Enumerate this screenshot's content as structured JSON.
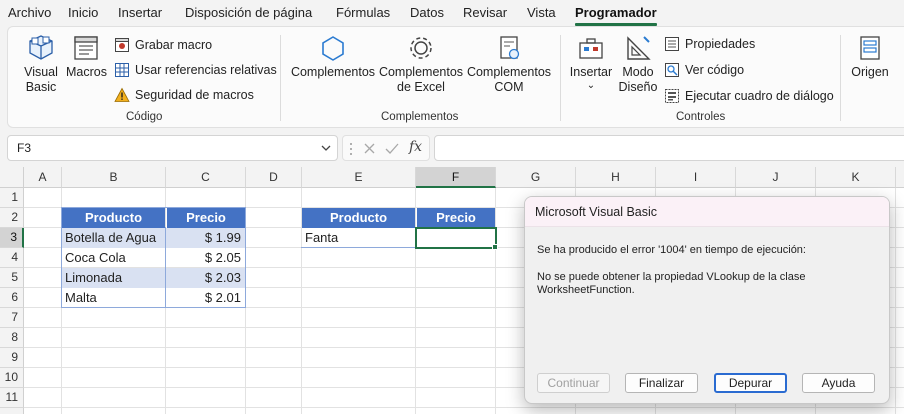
{
  "menu": {
    "tabs": [
      "Archivo",
      "Inicio",
      "Insertar",
      "Disposición de página",
      "Fórmulas",
      "Datos",
      "Revisar",
      "Vista",
      "Programador"
    ],
    "active": "Programador"
  },
  "ribbon": {
    "codigo": {
      "label": "Código",
      "visual_basic": [
        "Visual",
        "Basic"
      ],
      "macros": "Macros",
      "grabar_macro": "Grabar macro",
      "usar_referencias": "Usar referencias relativas",
      "seguridad": "Seguridad de macros"
    },
    "complementos": {
      "label": "Complementos",
      "complementos": "Complementos",
      "complementos_excel": [
        "Complementos",
        "de Excel"
      ],
      "complementos_com": [
        "Complementos",
        "COM"
      ]
    },
    "controles": {
      "label": "Controles",
      "insertar": "Insertar",
      "modo_diseno": [
        "Modo",
        "Diseño"
      ],
      "propiedades": "Propiedades",
      "ver_codigo": "Ver código",
      "ejecutar_cuadro": "Ejecutar cuadro de diálogo"
    },
    "xml": {
      "origen": "Origen"
    }
  },
  "formula_bar": {
    "name_box": "F3",
    "fx": "fx",
    "value": ""
  },
  "grid": {
    "columns": [
      "A",
      "B",
      "C",
      "D",
      "E",
      "F",
      "G",
      "H",
      "I",
      "J",
      "K"
    ],
    "rows": [
      "1",
      "2",
      "3",
      "4",
      "5",
      "6",
      "7",
      "8",
      "9",
      "10",
      "11"
    ],
    "selected_col": "F",
    "selected_row": "3",
    "table1": {
      "headers": [
        "Producto",
        "Precio"
      ],
      "rows": [
        [
          "Botella de Agua",
          "$ 1.99"
        ],
        [
          "Coca Cola",
          "$ 2.05"
        ],
        [
          "Limonada",
          "$ 2.03"
        ],
        [
          "Malta",
          "$ 2.01"
        ]
      ]
    },
    "table2": {
      "headers": [
        "Producto",
        "Precio"
      ],
      "rows": [
        [
          "Fanta",
          ""
        ]
      ]
    }
  },
  "dialog": {
    "title": "Microsoft Visual Basic",
    "error_line": "Se ha producido el error '1004' en tiempo de ejecución:",
    "message_line1": "No se puede obtener la propiedad VLookup de la clase",
    "message_line2": "WorksheetFunction.",
    "buttons": [
      "Continuar",
      "Finalizar",
      "Depurar",
      "Ayuda"
    ]
  },
  "colors": {
    "accent": "#217346",
    "table_header": "#4472c4",
    "table_band": "#d9e1f2",
    "dialog_title_bg": "#fbf1f7"
  }
}
